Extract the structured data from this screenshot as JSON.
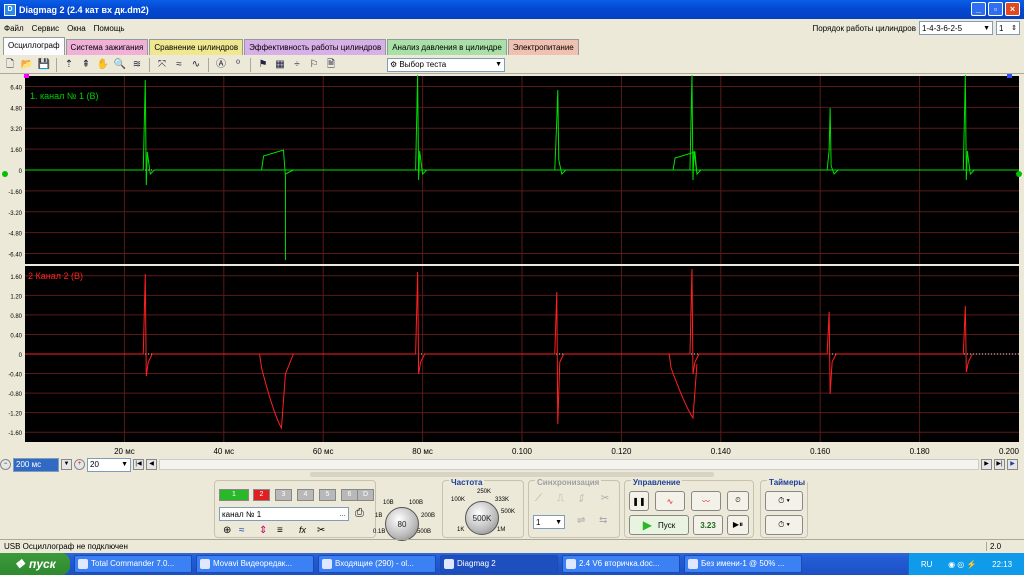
{
  "window": {
    "title": "Diagmag 2 (2.4 кат вх дк.dm2)"
  },
  "menu": [
    "Файл",
    "Сервис",
    "Окна",
    "Помощь"
  ],
  "cylinder_order": {
    "label": "Порядок работы цилиндров",
    "value": "1-4-3-6-2-5",
    "spin": "1"
  },
  "tabs": [
    {
      "label": "Осциллограф",
      "color": "#fcfcfe"
    },
    {
      "label": "Система зажигания",
      "color": "#f0b0d8"
    },
    {
      "label": "Сравнение цилиндров",
      "color": "#f0e890"
    },
    {
      "label": "Эффективность работы цилиндров",
      "color": "#d8b0e8"
    },
    {
      "label": "Анализ давления в цилиндре",
      "color": "#a8e0a8"
    },
    {
      "label": "Электропитание",
      "color": "#f0c0b0"
    }
  ],
  "toolbar": {
    "test_select": "Выбор теста"
  },
  "channel1": {
    "label": "1. канал № 1 (В)",
    "color": "#00d000",
    "ticks": [
      "6.40",
      "4.80",
      "3.20",
      "1.60",
      "0",
      "-1.60",
      "-3.20",
      "-4.80",
      "-6.40"
    ]
  },
  "channel2": {
    "label": "2 Канал 2 (В)",
    "color": "#ff2020",
    "ticks": [
      "1.60",
      "1.20",
      "0.80",
      "0.40",
      "0",
      "-0.40",
      "-0.80",
      "-1.20",
      "-1.60"
    ]
  },
  "xaxis": [
    "20 мс",
    "40 мс",
    "60 мс",
    "80 мс",
    "0.100",
    "0.120",
    "0.140",
    "0.160",
    "0.180",
    "0.200"
  ],
  "bottom_nav": {
    "timebase": "200 мс",
    "scale": "20"
  },
  "controls": {
    "channel_buttons": [
      "1",
      "2",
      "3",
      "4",
      "5",
      "6",
      "D"
    ],
    "channel_name": "канал № 1",
    "voltage_labels": [
      "10В",
      "100В",
      "1В",
      "200В",
      "0.1В",
      "500В"
    ],
    "voltage_value": "80",
    "freq_title": "Частота",
    "freq_labels": [
      "250K",
      "100K",
      "333K",
      "500K",
      "1K",
      "1M"
    ],
    "freq_value": "500K",
    "sync_title": "Синхронизация",
    "sync_value": "1",
    "control_title": "Управление",
    "run_label": "Пуск",
    "version": "3.23",
    "timers_title": "Таймеры"
  },
  "status": {
    "left": "USB Осциллограф не подключен",
    "right": "2.0"
  },
  "taskbar": {
    "start": "пуск",
    "tasks": [
      "Total Commander 7.0...",
      "Movavi Видеоредак...",
      "Входящие (290) - ol...",
      "Diagmag 2",
      "2.4 V6 вторичка.doc...",
      "Без имени-1 @ 50% ..."
    ],
    "lang": "RU",
    "time": "22:13"
  }
}
